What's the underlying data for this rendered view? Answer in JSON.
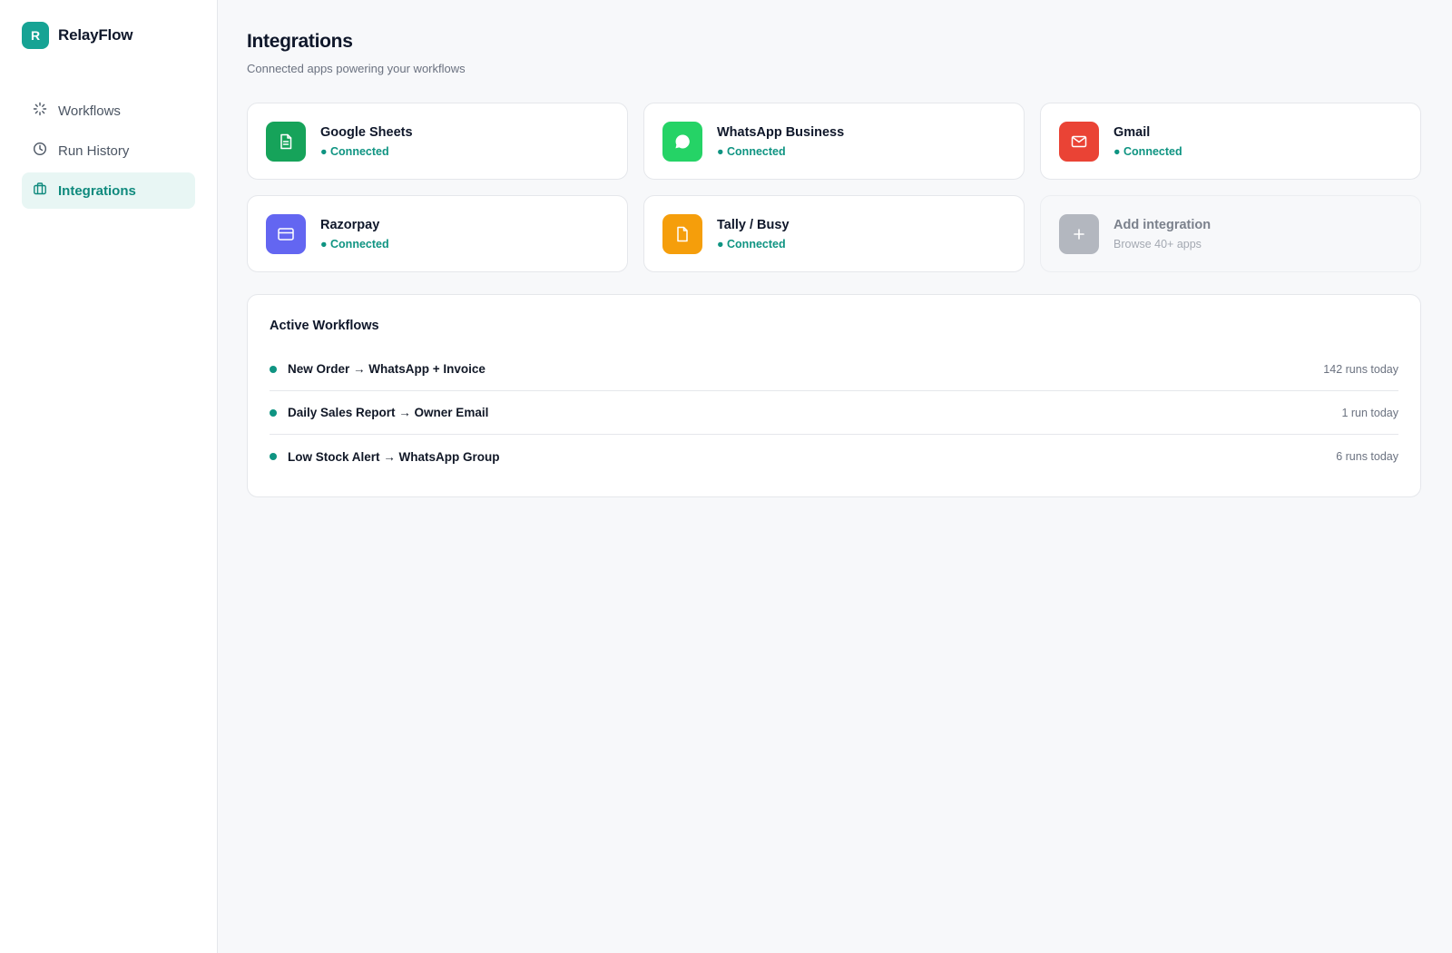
{
  "brand": {
    "logo_letter": "R",
    "name": "RelayFlow",
    "accent": "#16a394"
  },
  "nav": [
    {
      "label": "Workflows",
      "icon": "loader-icon",
      "active": false
    },
    {
      "label": "Run History",
      "icon": "clock-icon",
      "active": false
    },
    {
      "label": "Integrations",
      "icon": "briefcase-icon",
      "active": true
    }
  ],
  "page": {
    "title": "Integrations",
    "subtitle": "Connected apps powering your workflows"
  },
  "integrations": [
    {
      "name": "Google Sheets",
      "status": "● Connected",
      "icon": "sheet-icon",
      "color": "#16a35a"
    },
    {
      "name": "WhatsApp Business",
      "status": "● Connected",
      "icon": "chat-bubble-icon",
      "color": "#25d366"
    },
    {
      "name": "Gmail",
      "status": "● Connected",
      "icon": "mail-icon",
      "color": "#ea4335"
    },
    {
      "name": "Razorpay",
      "status": "● Connected",
      "icon": "credit-card-icon",
      "color": "#6366f1"
    },
    {
      "name": "Tally / Busy",
      "status": "● Connected",
      "icon": "file-icon",
      "color": "#f59e0b"
    },
    {
      "name": "Add integration",
      "status": "Browse 40+ apps",
      "icon": "plus-icon",
      "color": "#b3b7bf"
    }
  ],
  "workflows": {
    "title": "Active Workflows",
    "items": [
      {
        "name": "New Order → WhatsApp + Invoice",
        "runs": "142 runs today"
      },
      {
        "name": "Daily Sales Report → Owner Email",
        "runs": "1 run today"
      },
      {
        "name": "Low Stock Alert → WhatsApp Group",
        "runs": "6 runs today"
      }
    ]
  }
}
